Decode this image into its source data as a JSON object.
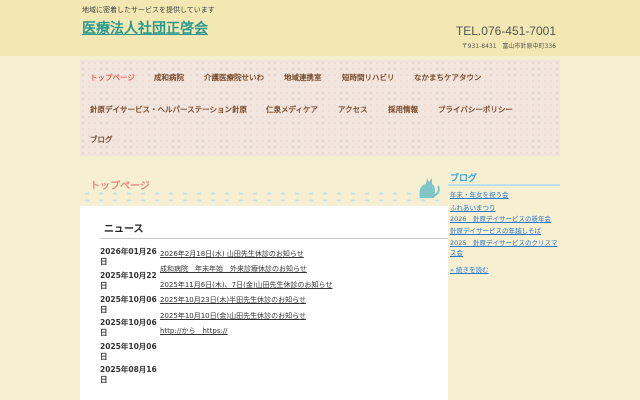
{
  "header": {
    "tagline": "地域に密着したサービスを提供しています",
    "title": "医療法人社団正啓会",
    "tel": "TEL.076-451-7001",
    "address": "〒931-8431　富山市針原中町336"
  },
  "nav": {
    "items": [
      "トップページ",
      "成和病院",
      "介護医療院せいわ",
      "地域連携室",
      "短時間リハビリ",
      "なかまちケアタウン",
      "針原デイサービス・ヘルパーステーション針原",
      "仁泉メディケア",
      "アクセス",
      "採用情報",
      "プライバシーポリシー",
      "ブログ"
    ]
  },
  "main": {
    "section_title": "トップページ",
    "news_title": "ニュース",
    "news": [
      {
        "date": "2026年01月26日",
        "text": "2026年2月18日(水) 山田先生休診のお知らせ"
      },
      {
        "date": "2025年10月22日",
        "text": "成和病院　年末年始　外来診療休診のお知らせ"
      },
      {
        "date": "2025年10月06日",
        "text": "2025年11月6日(木)、7日(金)山田先生休診のお知らせ"
      },
      {
        "date": "2025年10月06日",
        "text": "2025年10月23日(木)半田先生休診のお知らせ"
      },
      {
        "date": "2025年10月06日",
        "text": "2025年10月10日(金)山田先生休診のお知らせ"
      },
      {
        "date": "2025年08月16日",
        "text": "http://から　https://"
      }
    ]
  },
  "sidebar": {
    "title": "ブログ",
    "links": [
      "年末・年女を祝う会",
      "ふれあいまつり",
      "2026　針原デイサービスの新年会",
      "針原デイサービスの年越しそば",
      "2025　針原デイサービスのクリスマス会"
    ],
    "more": "» 続きを読む"
  }
}
